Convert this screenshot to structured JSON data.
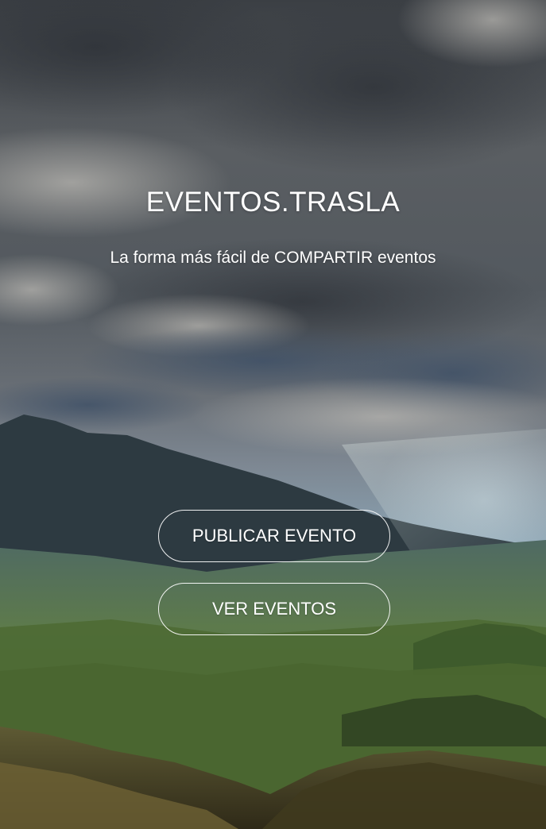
{
  "hero": {
    "title": "EVENTOS.TRASLA",
    "tagline": "La forma más fácil de COMPARTIR eventos",
    "background": "mountain-valley-stormy-sky-photo"
  },
  "actions": {
    "publish_label": "PUBLICAR EVENTO",
    "view_label": "VER EVENTOS"
  },
  "colors": {
    "text": "#ffffff",
    "button_border": "#ffffff"
  }
}
